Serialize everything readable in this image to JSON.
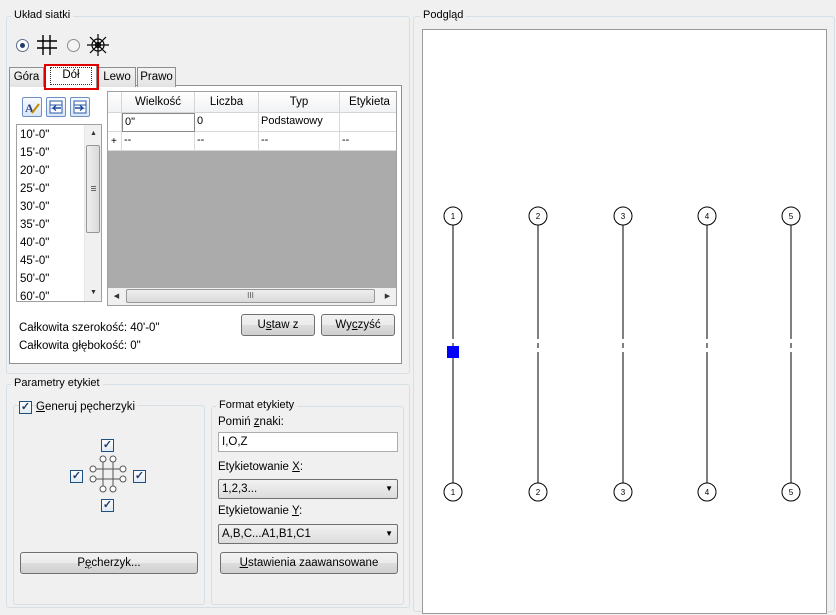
{
  "grid_layout": {
    "title": "Układ siatki",
    "tabs": [
      "Góra",
      "Dół",
      "Lewo",
      "Prawo"
    ],
    "active_tab": "Dół",
    "highlight_color": "#e00000",
    "sizes": [
      "10'-0\"",
      "15'-0\"",
      "20'-0\"",
      "25'-0\"",
      "30'-0\"",
      "35'-0\"",
      "40'-0\"",
      "45'-0\"",
      "50'-0\"",
      "60'-0\""
    ],
    "table": {
      "columns": [
        "Wielkość",
        "Liczba",
        "Typ",
        "Etykieta"
      ],
      "rows": [
        {
          "marker": "",
          "cells": [
            "0\"",
            "0",
            "Podstawowy",
            ""
          ]
        },
        {
          "marker": "+",
          "cells": [
            "--",
            "--",
            "--",
            "--"
          ]
        }
      ]
    },
    "total_width": "Całkowita szerokość: 40'-0\"",
    "total_depth": "Całkowita głębokość: 0\"",
    "btn_set_from": {
      "pre": "U",
      "key": "s",
      "post": "taw z"
    },
    "btn_clear": {
      "pre": "Wy",
      "key": "c",
      "post": "zyść"
    },
    "hscroll_grip": "III"
  },
  "label_params": {
    "title": "Parametry etykiet",
    "generate": {
      "pre": "",
      "key": "G",
      "post": "eneruj pęcherzyki",
      "checked": true
    },
    "bubble_btn": {
      "pre": "P",
      "key": "ę",
      "post": "cherzyk..."
    },
    "format_title": "Format etykiety",
    "skip_chars": {
      "pre": "Pomiń ",
      "key": "z",
      "post": "naki:"
    },
    "skip_value": "I,O,Z",
    "label_x": {
      "pre": "Etykietowanie ",
      "key": "X",
      "post": ":"
    },
    "label_x_value": "1,2,3...",
    "label_y": {
      "pre": "Etykietowanie ",
      "key": "Y",
      "post": ":"
    },
    "label_y_value": "A,B,C...A1,B1,C1",
    "advanced": {
      "pre": "",
      "key": "U",
      "post": "stawienia zaawansowane"
    }
  },
  "preview": {
    "title": "Podgląd",
    "bubbles": [
      "1",
      "2",
      "3",
      "4",
      "5"
    ],
    "selected_color": "#0000ff"
  }
}
